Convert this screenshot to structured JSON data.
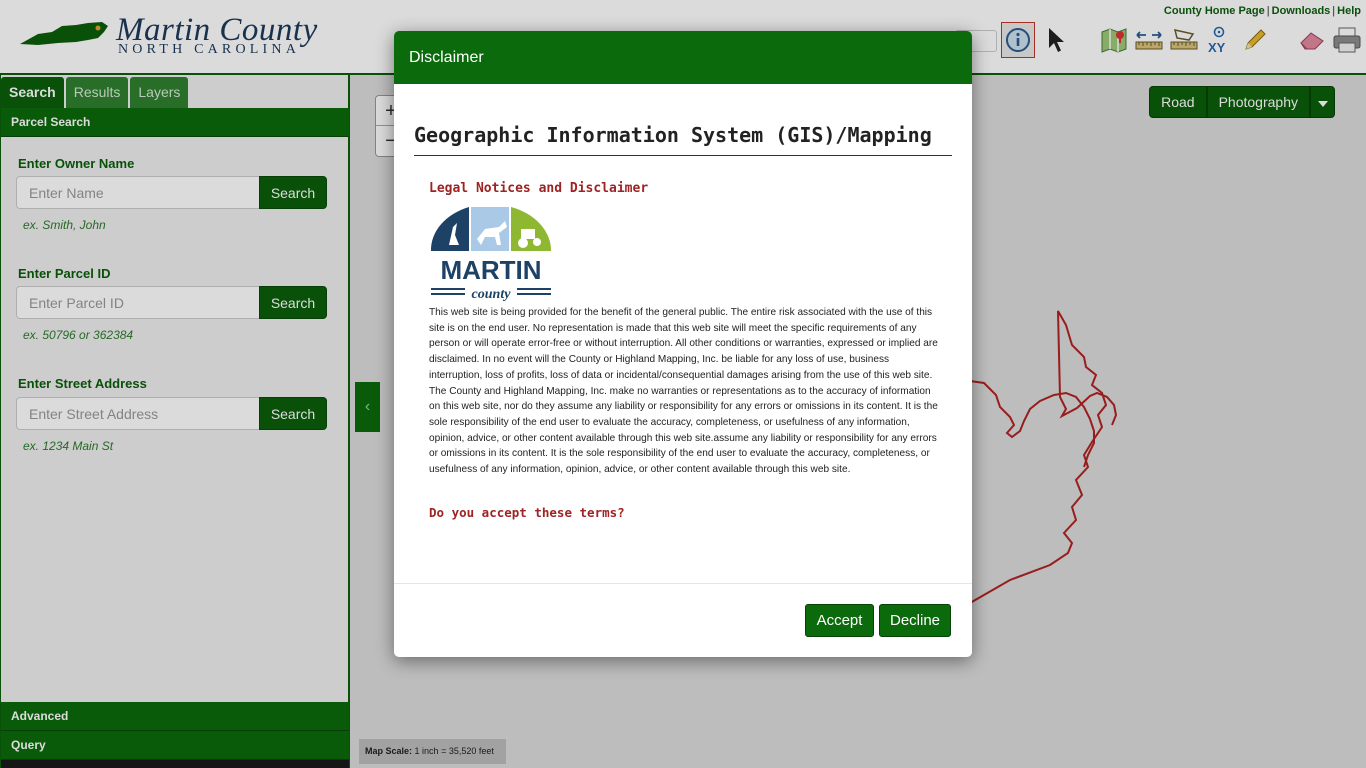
{
  "header": {
    "title": "Martin County",
    "subtitle": "NORTH CAROLINA",
    "links": [
      "County Home Page",
      "Downloads",
      "Help"
    ],
    "tools": [
      "identify-icon",
      "select-arrow-icon",
      "map-layers-icon",
      "measure-icon",
      "ruler-icon",
      "xy-coordinates-icon",
      "draw-pencil-icon",
      "eraser-icon",
      "print-icon"
    ]
  },
  "sidebar": {
    "tabs": [
      "Search",
      "Results",
      "Layers"
    ],
    "active_tab": "Search",
    "section_title": "Parcel Search",
    "fields": [
      {
        "label": "Enter Owner Name",
        "placeholder": "Enter Name",
        "button": "Search",
        "example": "ex. Smith, John"
      },
      {
        "label": "Enter Parcel ID",
        "placeholder": "Enter Parcel ID",
        "button": "Search",
        "example": "ex. 50796 or 362384"
      },
      {
        "label": "Enter Street Address",
        "placeholder": "Enter Street Address",
        "button": "Search",
        "example": "ex. 1234 Main St"
      }
    ],
    "advanced_label": "Advanced",
    "query_label": "Query"
  },
  "map": {
    "zoom_in": "+",
    "zoom_out": "−",
    "basemap_buttons": [
      "Road",
      "Photography"
    ],
    "scale_label": "Map Scale:",
    "scale_value": "1 inch = 35,520 feet",
    "outline_color": "#b22222"
  },
  "modal": {
    "header": "Disclaimer",
    "title": "Geographic Information System (GIS)/Mapping",
    "legal_heading": "Legal Notices and Disclaimer",
    "logo_text": "MARTIN",
    "logo_subtext": "county",
    "body": "This web site is being provided for the benefit of the general public. The entire risk associated with the use of this site is on the end user. No representation is made that this web site will meet the specific requirements of any person or will operate error-free or without interruption. All other conditions or warranties, expressed or implied are disclaimed. In no event will the County or Highland Mapping, Inc. be liable for any loss of use, business interruption, loss of profits, loss of data or incidental/consequential damages arising from the use of this web site. The County and Highland Mapping, Inc. make no warranties or representations as to the accuracy of information on this web site, nor do they assume any liability or responsibility for any errors or omissions in its content. It is the sole responsibility of the end user to evaluate the accuracy, completeness, or usefulness of any information, opinion, advice, or other content available through this web site.assume any liability or responsibility for any errors or omissions in its content. It is the sole responsibility of the end user to evaluate the accuracy, completeness, or usefulness of any information, opinion, advice, or other content available through this web site.",
    "question": "Do you accept these terms?",
    "accept_label": "Accept",
    "decline_label": "Decline"
  },
  "colors": {
    "primary_green": "#0b5e0b",
    "accent_red": "#9e2323"
  }
}
